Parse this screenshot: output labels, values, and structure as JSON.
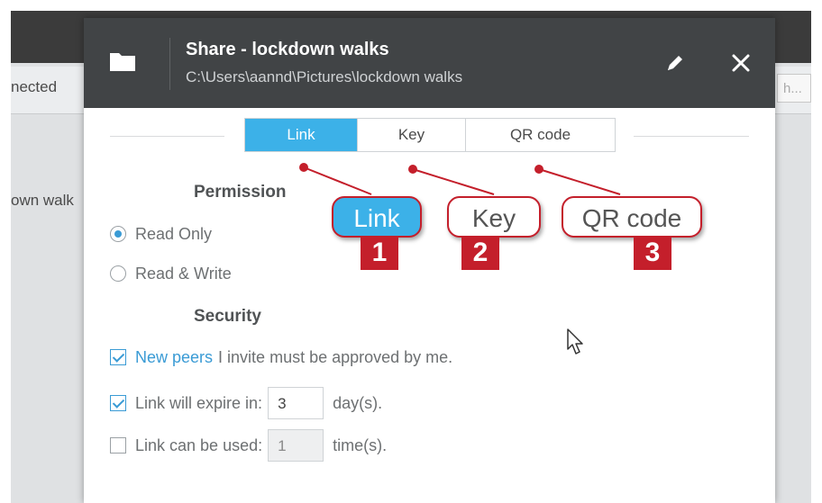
{
  "background": {
    "left_status": "nected",
    "left_item": "own walk",
    "right_field": "h..."
  },
  "dialog": {
    "title": "Share - lockdown walks",
    "path": "C:\\Users\\aannd\\Pictures\\lockdown walks",
    "icons": {
      "folder": "folder-icon",
      "edit": "pencil-icon",
      "close": "close-icon"
    }
  },
  "tabs": [
    {
      "label": "Link",
      "active": true
    },
    {
      "label": "Key",
      "active": false
    },
    {
      "label": "QR code",
      "active": false
    }
  ],
  "permission": {
    "title": "Permission",
    "options": [
      {
        "label": "Read Only",
        "selected": true
      },
      {
        "label": "Read & Write",
        "selected": false
      }
    ]
  },
  "security": {
    "title": "Security",
    "approve": {
      "checked": true,
      "link_text": "New peers",
      "text": "I invite must be approved by me."
    },
    "expire": {
      "checked": true,
      "label": "Link will expire in:",
      "value": "3",
      "unit": "day(s)."
    },
    "uses": {
      "checked": false,
      "label": "Link can be used:",
      "value": "1",
      "unit": "time(s)."
    }
  },
  "annotations": [
    {
      "label": "Link",
      "number": "1"
    },
    {
      "label": "Key",
      "number": "2"
    },
    {
      "label": "QR code",
      "number": "3"
    }
  ],
  "colors": {
    "accent": "#3cb1e8",
    "annotation_red": "#c41f2b",
    "header": "#414446"
  }
}
